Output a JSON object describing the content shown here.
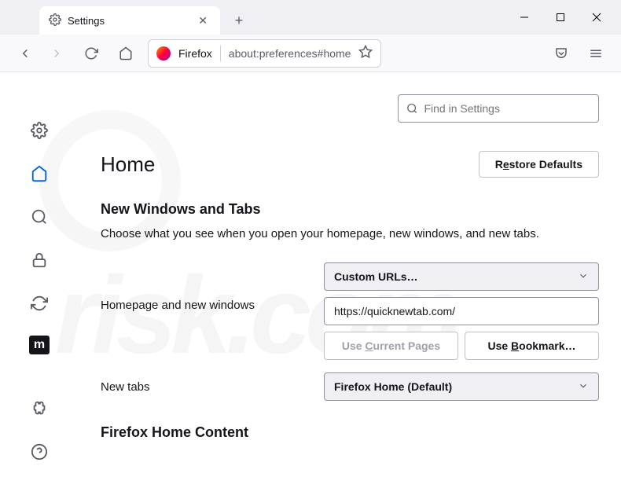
{
  "tab": {
    "title": "Settings"
  },
  "urlbar": {
    "firefox_label": "Firefox",
    "url": "about:preferences#home"
  },
  "search": {
    "placeholder": "Find in Settings"
  },
  "page": {
    "title": "Home"
  },
  "buttons": {
    "restore_pre": "R",
    "restore_u": "e",
    "restore_post": "store Defaults",
    "use_current_pre": "Use ",
    "use_current_u": "C",
    "use_current_post": "urrent Pages",
    "use_bookmark_pre": "Use ",
    "use_bookmark_u": "B",
    "use_bookmark_post": "ookmark…"
  },
  "section": {
    "heading": "New Windows and Tabs",
    "desc": "Choose what you see when you open your homepage, new windows, and new tabs."
  },
  "homepage": {
    "label": "Homepage and new windows",
    "mode": "Custom URLs…",
    "url": "https://quicknewtab.com/"
  },
  "newtabs": {
    "label": "New tabs",
    "mode": "Firefox Home (Default)"
  },
  "home_content": {
    "heading": "Firefox Home Content"
  },
  "watermark": {
    "text": "risk.com"
  }
}
